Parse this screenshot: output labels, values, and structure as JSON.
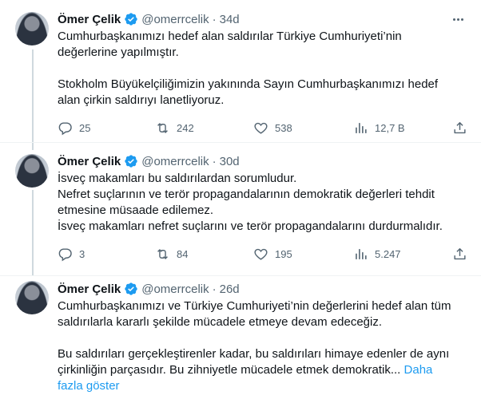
{
  "tweets": [
    {
      "name": "Ömer Çelik",
      "handle": "@omerrcelik",
      "dot": "·",
      "time": "34d",
      "paragraphs": [
        "Cumhurbaşkanımızı hedef alan saldırılar Türkiye Cumhuriyeti’nin",
        "değerlerine yapılmıştır.",
        "",
        "Stokholm Büyükelçiliğimizin yakınında Sayın Cumhurbaşkanımızı hedef",
        "alan çirkin saldırıyı lanetliyoruz."
      ],
      "replies": "25",
      "retweets": "242",
      "likes": "538",
      "views": "12,7 B"
    },
    {
      "name": "Ömer Çelik",
      "handle": "@omerrcelik",
      "dot": "·",
      "time": "30d",
      "paragraphs": [
        "İsveç makamları bu saldırılardan sorumludur.",
        "Nefret suçlarının ve terör propagandalarının demokratik değerleri tehdit",
        "etmesine müsaade edilemez.",
        "İsveç makamları nefret suçlarını ve terör propagandalarını durdurmalıdır."
      ],
      "replies": "3",
      "retweets": "84",
      "likes": "195",
      "views": "5.247"
    },
    {
      "name": "Ömer Çelik",
      "handle": "@omerrcelik",
      "dot": "·",
      "time": "26d",
      "paragraphs": [
        "Cumhurbaşkanımızı ve Türkiye Cumhuriyeti’nin değerlerini hedef alan tüm",
        "saldırılarla kararlı şekilde mücadele etmeye devam edeceğiz.",
        "",
        "Bu saldırıları gerçekleştirenler kadar, bu saldırıları himaye edenler de aynı",
        "çirkinliğin parçasıdır. Bu zihniyetle mücadele etmek demokratik..."
      ],
      "show_more_1": "Daha",
      "show_more_2": "fazla göster"
    }
  ],
  "colors": {
    "verified": "#1d9bf0",
    "secondary_text": "#536471",
    "link": "#1d9bf0",
    "thread_line": "#cfd9de"
  }
}
